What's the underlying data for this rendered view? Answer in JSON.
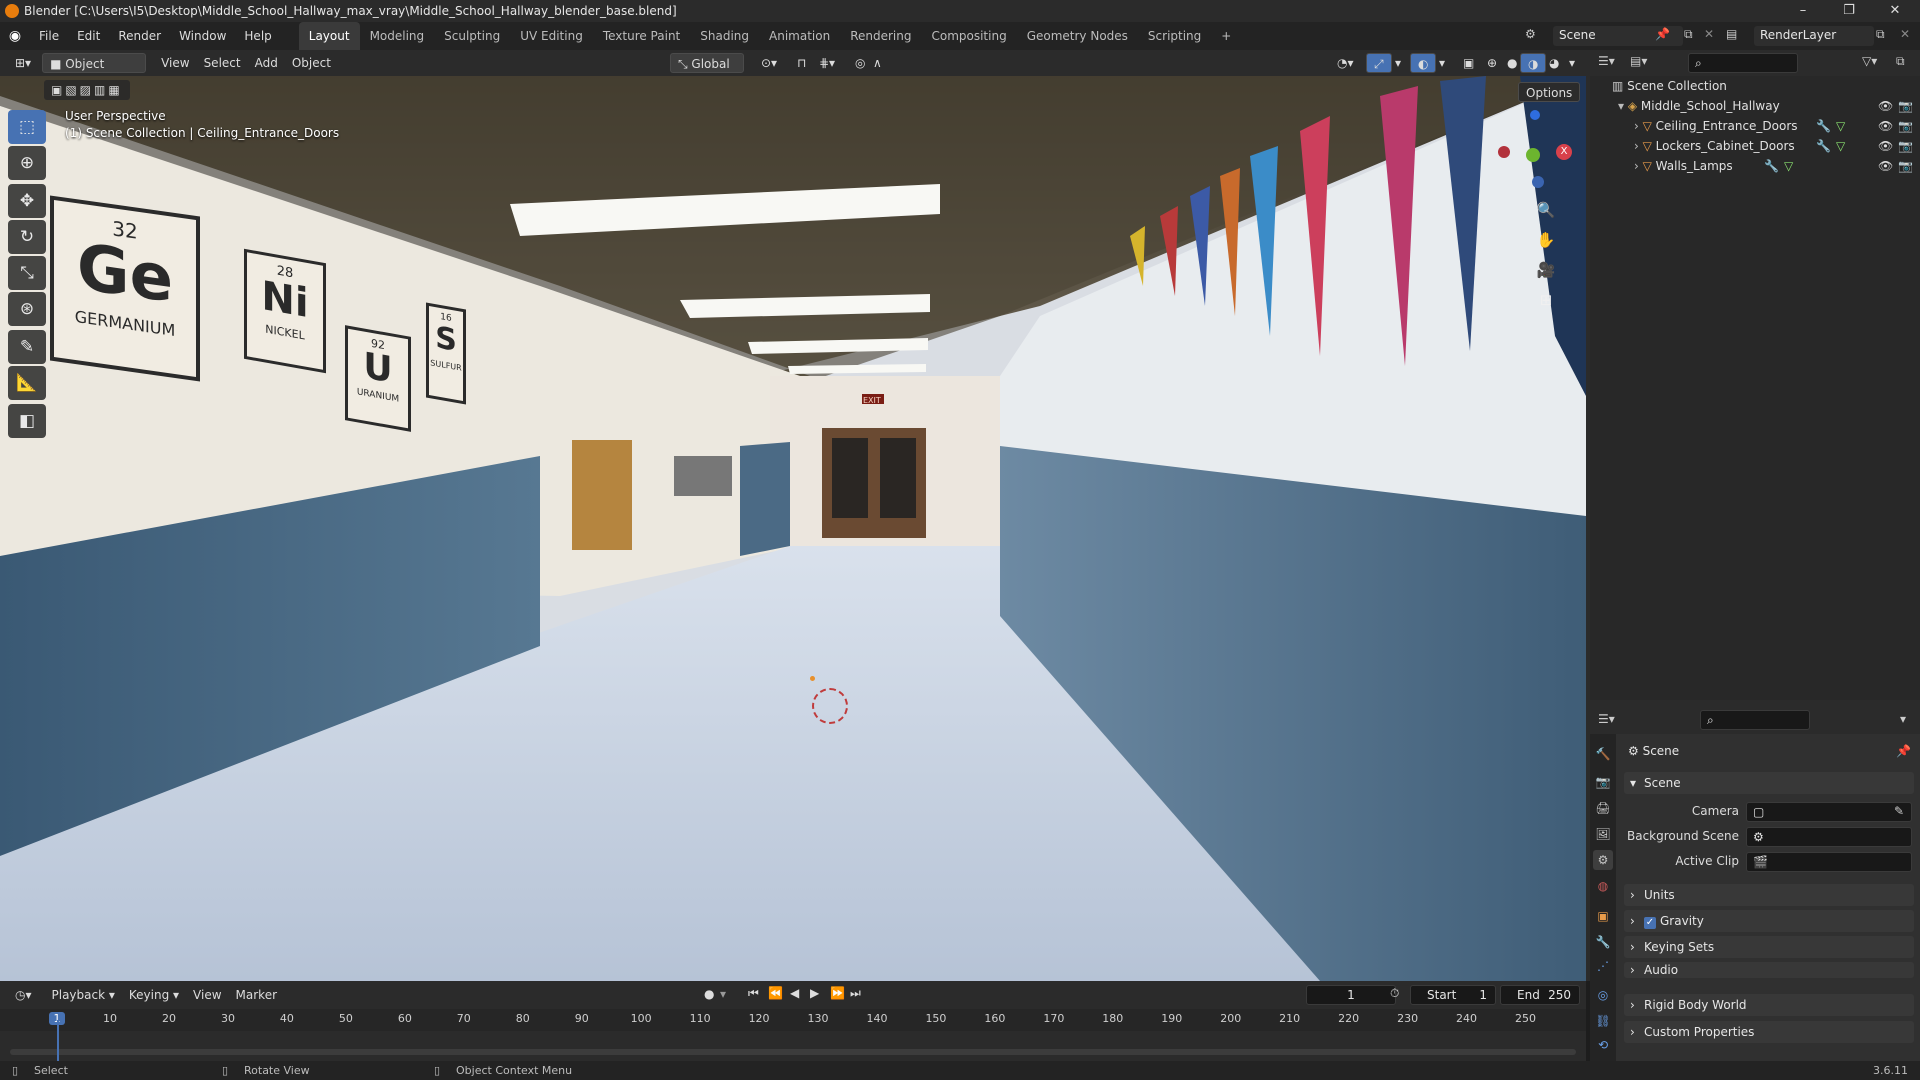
{
  "window": {
    "title": "Blender [C:\\Users\\I5\\Desktop\\Middle_School_Hallway_max_vray\\Middle_School_Hallway_blender_base.blend]",
    "controls": [
      "–",
      "❐",
      "✕"
    ]
  },
  "menus": [
    "File",
    "Edit",
    "Render",
    "Window",
    "Help"
  ],
  "workspaces": [
    "Layout",
    "Modeling",
    "Sculpting",
    "UV Editing",
    "Texture Paint",
    "Shading",
    "Animation",
    "Rendering",
    "Compositing",
    "Geometry Nodes",
    "Scripting",
    "+"
  ],
  "active_workspace": "Layout",
  "scene_name": "Scene",
  "render_layer": "RenderLayer",
  "viewport_header": {
    "mode": "Object Mode",
    "menus": [
      "View",
      "Select",
      "Add",
      "Object"
    ],
    "orientation": "Global",
    "options": "Options"
  },
  "viewport": {
    "perspective": "User Perspective",
    "collection_info": "(1) Scene Collection | Ceiling_Entrance_Doors"
  },
  "scene_text": {
    "elements": [
      {
        "number": "32",
        "symbol": "Ge",
        "name": "GERMANIUM"
      },
      {
        "number": "28",
        "symbol": "Ni",
        "name": "NICKEL"
      },
      {
        "number": "92",
        "symbol": "U",
        "name": "URANIUM"
      },
      {
        "number": "16",
        "symbol": "S",
        "name": "SULFUR"
      }
    ],
    "exit_sign": "EXIT"
  },
  "outliner": {
    "root": "Scene Collection",
    "collection": "Middle_School_Hallway",
    "items": [
      "Ceiling_Entrance_Doors",
      "Lockers_Cabinet_Doors",
      "Walls_Lamps"
    ]
  },
  "properties": {
    "header": "Scene",
    "section": "Scene",
    "fields": [
      {
        "label": "Camera",
        "value": ""
      },
      {
        "label": "Background Scene",
        "value": ""
      },
      {
        "label": "Active Clip",
        "value": ""
      }
    ],
    "panels": [
      "Units",
      "Gravity",
      "Keying Sets",
      "Audio",
      "Rigid Body World",
      "Custom Properties"
    ],
    "gravity_checked": true
  },
  "timeline": {
    "menus": [
      "Playback",
      "Keying",
      "View",
      "Marker"
    ],
    "current_frame": "1",
    "start_label": "Start",
    "start": "1",
    "end_label": "End",
    "end": "250",
    "ticks": [
      "1",
      "10",
      "20",
      "30",
      "40",
      "50",
      "60",
      "70",
      "80",
      "90",
      "100",
      "110",
      "120",
      "130",
      "140",
      "150",
      "160",
      "170",
      "180",
      "190",
      "200",
      "210",
      "220",
      "230",
      "240",
      "250"
    ]
  },
  "status": {
    "select": "Select",
    "rotate": "Rotate View",
    "context": "Object Context Menu",
    "version": "3.6.11"
  }
}
